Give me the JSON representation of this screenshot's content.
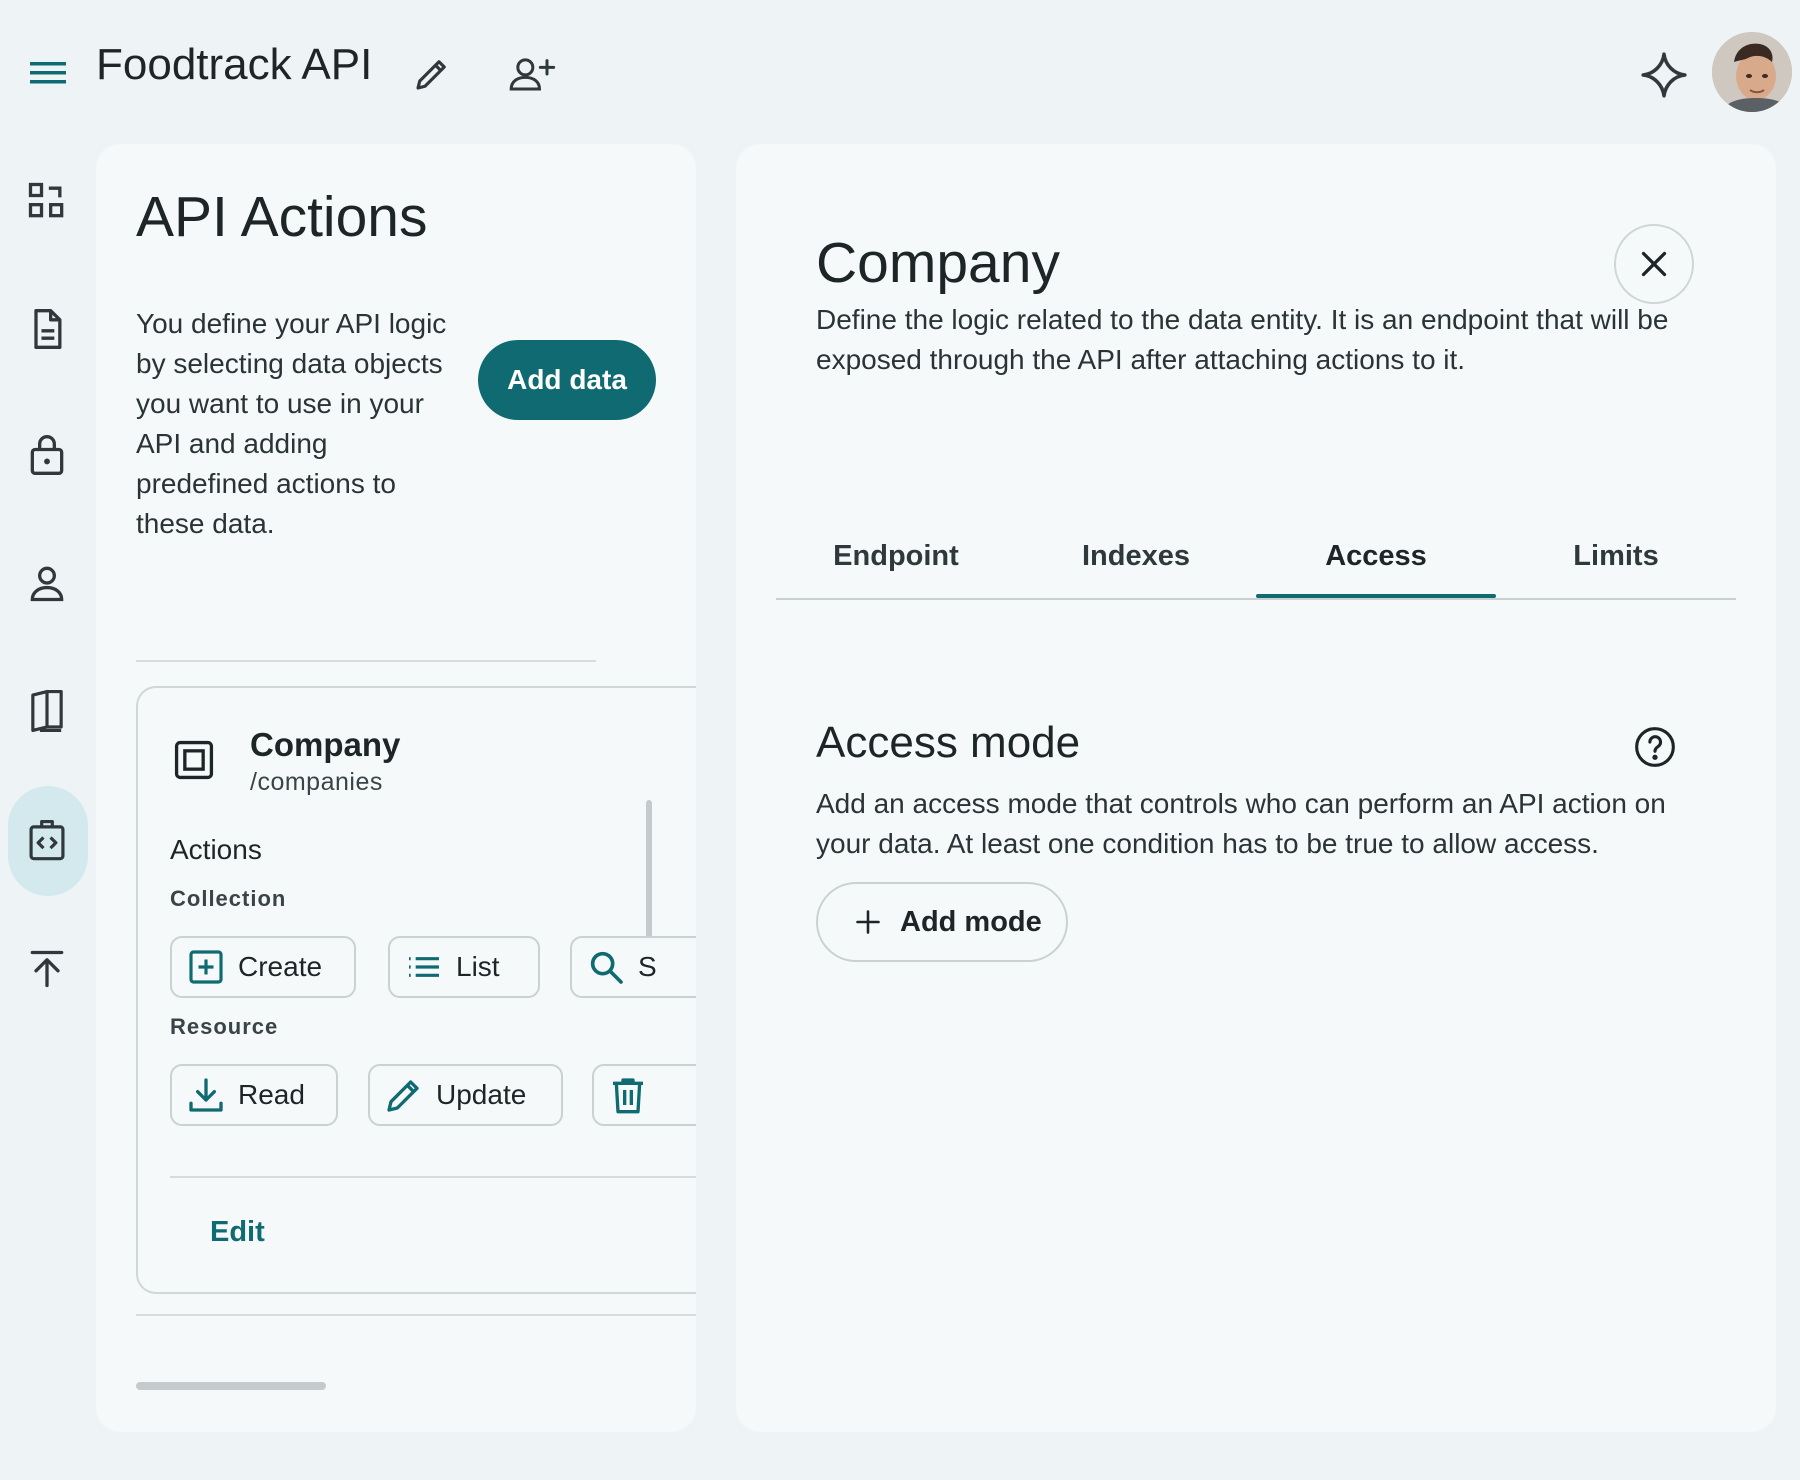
{
  "app": {
    "title": "Foodtrack API"
  },
  "left_panel": {
    "title": "API Actions",
    "description": "You define your API logic by selecting data objects you want to use in your API and adding predefined actions to these data.",
    "add_data_label": "Add data",
    "entity_card": {
      "name": "Company",
      "path": "/companies",
      "actions_heading": "Actions",
      "collection_label": "Collection",
      "collection_actions": [
        {
          "label": "Create",
          "icon": "add-box-icon"
        },
        {
          "label": "List",
          "icon": "list-icon"
        },
        {
          "label": "S",
          "icon": "search-icon"
        }
      ],
      "resource_label": "Resource",
      "resource_actions": [
        {
          "label": "Read",
          "icon": "download-icon"
        },
        {
          "label": "Update",
          "icon": "pencil-icon"
        },
        {
          "label": "",
          "icon": "trash-icon"
        }
      ],
      "edit_label": "Edit"
    }
  },
  "right_panel": {
    "title": "Company",
    "description": "Define the logic related to the data entity. It is an endpoint that will be exposed through the API after attaching actions to it.",
    "tabs": [
      {
        "label": "Endpoint",
        "active": false
      },
      {
        "label": "Indexes",
        "active": false
      },
      {
        "label": "Access",
        "active": true
      },
      {
        "label": "Limits",
        "active": false
      }
    ],
    "access_mode": {
      "title": "Access mode",
      "description": "Add an access mode that controls who can perform an API action on your data. At least one condition has to be true to allow access.",
      "add_mode_label": "Add mode"
    }
  },
  "rail": {
    "items": [
      {
        "icon": "dashboard-icon",
        "active": false
      },
      {
        "icon": "document-icon",
        "active": false
      },
      {
        "icon": "lock-icon",
        "active": false
      },
      {
        "icon": "person-icon",
        "active": false
      },
      {
        "icon": "book-icon",
        "active": false
      },
      {
        "icon": "api-code-icon",
        "active": true
      },
      {
        "icon": "publish-icon",
        "active": false
      }
    ]
  },
  "colors": {
    "accent": "#0f6b71",
    "background": "#eef3f5",
    "panel": "#f5f9fa",
    "rail_active": "#d3e9ee"
  }
}
